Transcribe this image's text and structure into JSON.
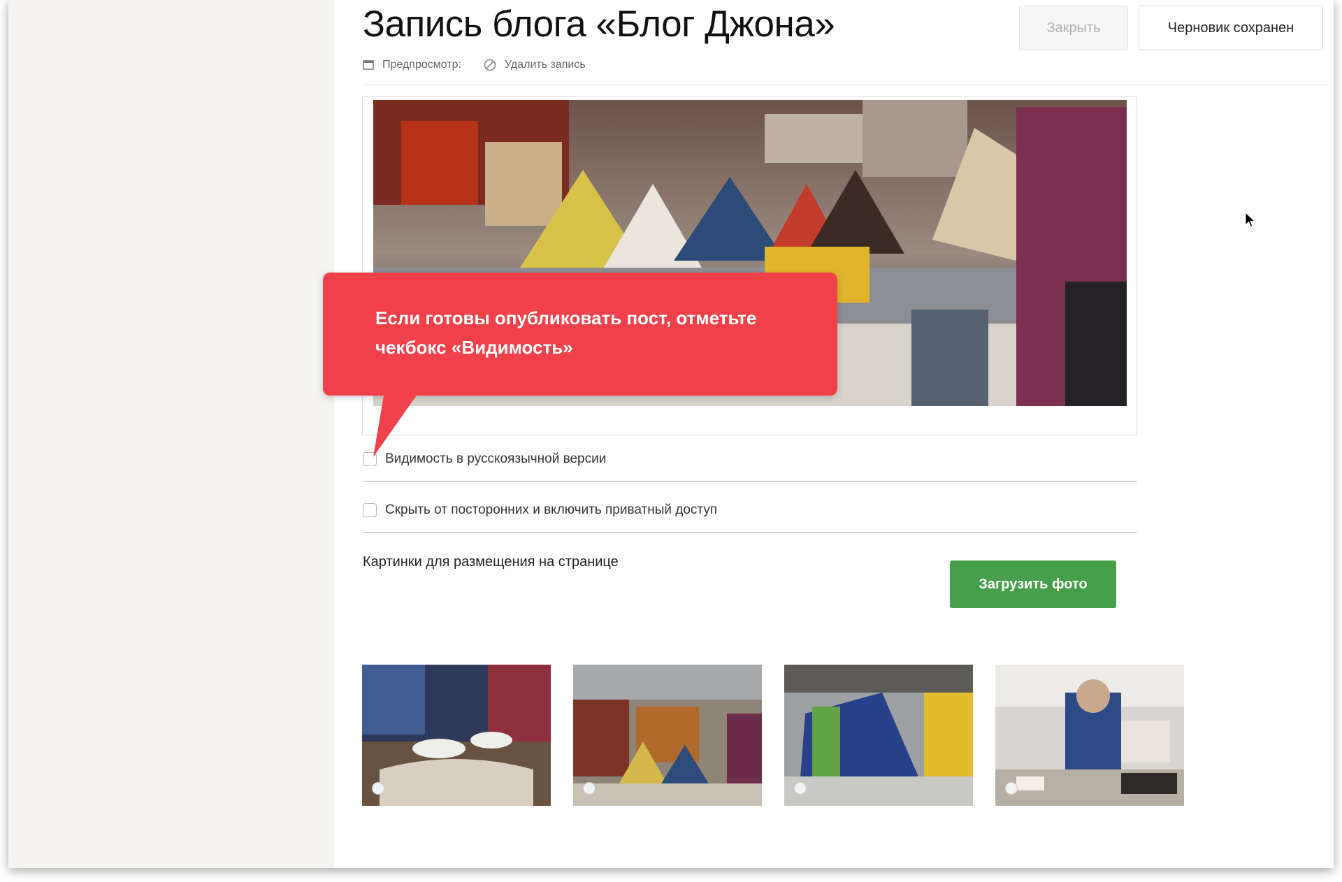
{
  "header": {
    "title": "Запись блога «Блог Джона»",
    "close_label": "Закрыть",
    "draft_label": "Черновик сохранен",
    "preview_label": "Предпросмотр:",
    "delete_label": "Удалить запись"
  },
  "options": {
    "visibility_label": "Видимость в русскоязычной версии",
    "private_label": "Скрыть от посторонних и включить приватный доступ"
  },
  "gallery": {
    "section_label": "Картинки для размещения на странице",
    "upload_label": "Загрузить фото"
  },
  "callout": {
    "text": "Если готовы опубликовать пост, отметьте чекбокс «Видимость»"
  },
  "colors": {
    "callout": "#f0404a",
    "upload_button": "#45a049",
    "sidebar": "#f4f3ef"
  }
}
